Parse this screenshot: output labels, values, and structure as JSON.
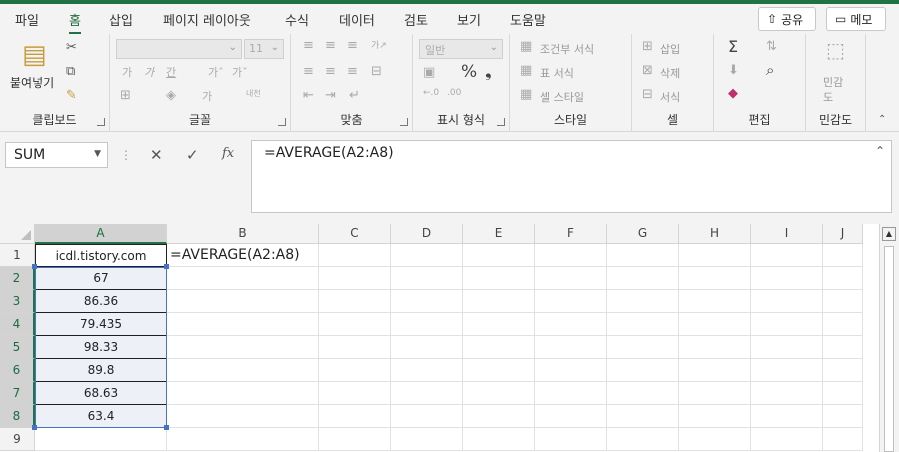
{
  "tabs": [
    "파일",
    "홈",
    "삽입",
    "페이지 레이아웃",
    "수식",
    "데이터",
    "검토",
    "보기",
    "도움말"
  ],
  "share_label": "공유",
  "memo_label": "메모",
  "ribbon": {
    "clipboard": {
      "label": "클립보드",
      "paste": "붙여넣기"
    },
    "font": {
      "label": "글꼴",
      "size": "11"
    },
    "align": {
      "label": "맞춤"
    },
    "number": {
      "label": "표시 형식",
      "format": "일반"
    },
    "style": {
      "label": "스타일",
      "cond": "조건부 서식",
      "table": "표 서식",
      "cell": "셀 스타일"
    },
    "cells": {
      "label": "셀",
      "insert": "삽입",
      "delete": "삭제",
      "format": "서식"
    },
    "edit": {
      "label": "편집"
    },
    "sensitivity": {
      "label": "민감도",
      "btn1": "민감",
      "btn2": "도"
    }
  },
  "formula_bar": {
    "name_box": "SUM",
    "formula": "=AVERAGE(A2:A8)"
  },
  "columns": [
    "A",
    "B",
    "C",
    "D",
    "E",
    "F",
    "G",
    "H",
    "I",
    "J"
  ],
  "rows": [
    "1",
    "2",
    "3",
    "4",
    "5",
    "6",
    "7",
    "8",
    "9"
  ],
  "cells": {
    "A1": "icdl.tistory.com",
    "A2": "67",
    "A3": "86.36",
    "A4": "79.435",
    "A5": "98.33",
    "A6": "89.8",
    "A7": "68.63",
    "A8": "63.4",
    "B1": "=AVERAGE(A2:A8)"
  }
}
